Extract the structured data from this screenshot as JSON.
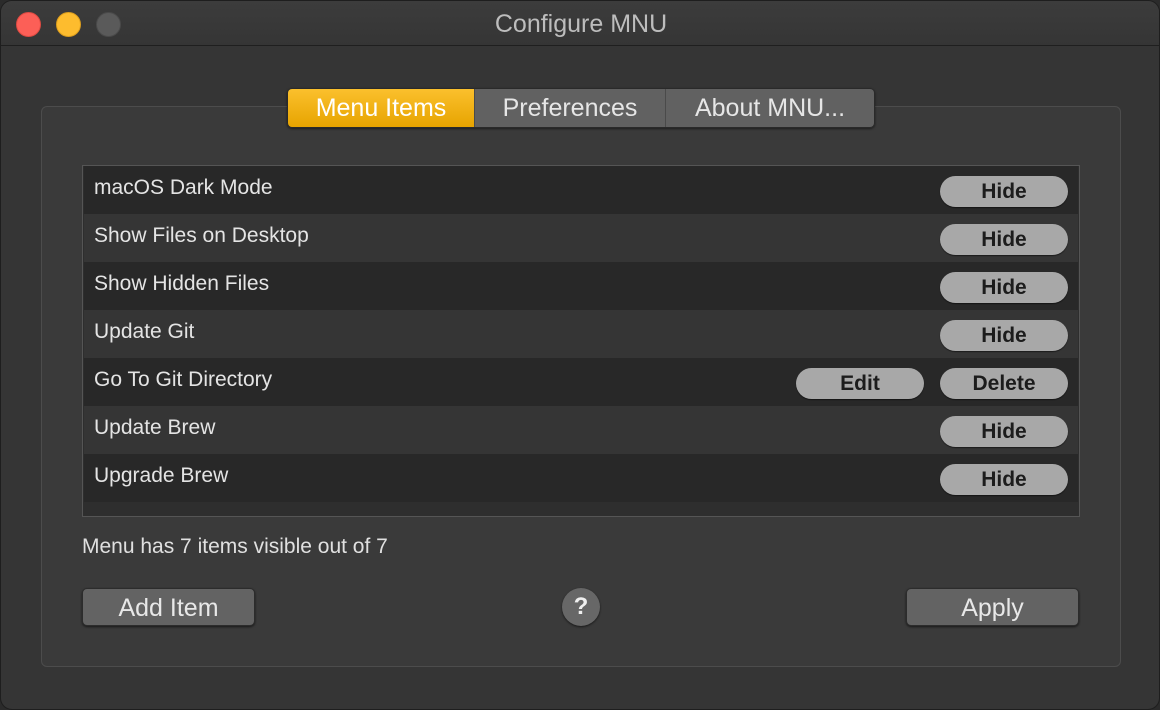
{
  "window": {
    "title": "Configure MNU"
  },
  "tabs": [
    {
      "label": "Menu Items",
      "active": true
    },
    {
      "label": "Preferences",
      "active": false
    },
    {
      "label": "About MNU...",
      "active": false
    }
  ],
  "items": [
    {
      "label": "macOS Dark Mode",
      "action": "Hide"
    },
    {
      "label": "Show Files on Desktop",
      "action": "Hide"
    },
    {
      "label": "Show Hidden Files",
      "action": "Hide"
    },
    {
      "label": "Update Git",
      "action": "Hide"
    },
    {
      "label": "Go To Git Directory",
      "edit": "Edit",
      "action": "Delete"
    },
    {
      "label": "Update Brew",
      "action": "Hide"
    },
    {
      "label": "Upgrade Brew",
      "action": "Hide"
    }
  ],
  "status": "Menu has 7 items visible out of 7",
  "footer": {
    "add_label": "Add Item",
    "help_label": "?",
    "apply_label": "Apply"
  },
  "colors": {
    "accent": "#f0b10e",
    "close": "#fc5f57",
    "minimize": "#fdbc2e",
    "zoom": "#5a5a5a"
  }
}
